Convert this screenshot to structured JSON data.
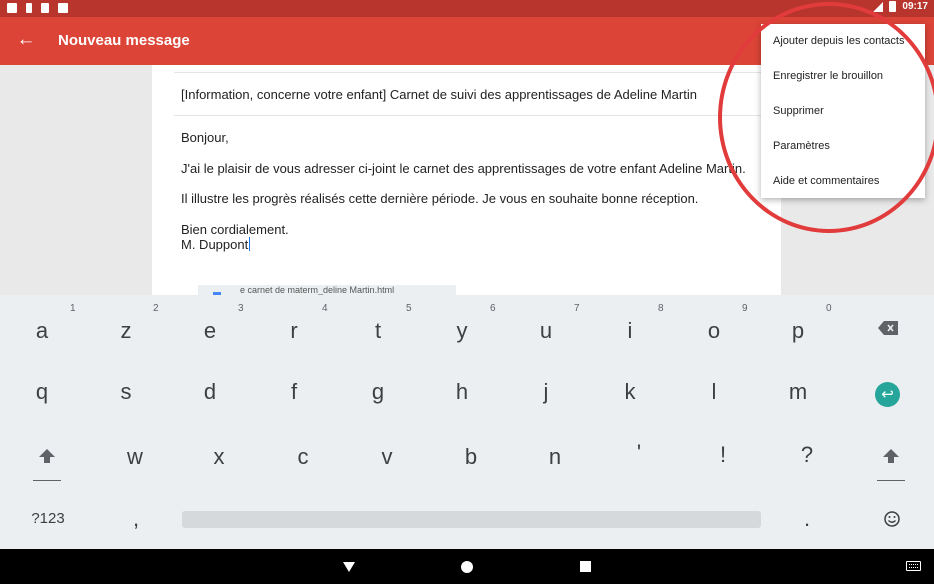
{
  "status_bar": {
    "time": "09:17",
    "left_icons": [
      "mail-icon",
      "notification-icon",
      "sd-card-icon",
      "app-icon"
    ],
    "right_icons": [
      "wifi-icon",
      "signal-icon",
      "battery-icon"
    ]
  },
  "app_bar": {
    "title": "Nouveau message",
    "back_icon": "arrow-left-icon",
    "color": "#db4437"
  },
  "compose": {
    "subject": "[Information, concerne votre enfant] Carnet de suivi des apprentissages de Adeline Martin",
    "body": {
      "greeting": "Bonjour,",
      "line1": "J'ai le plaisir de vous adresser ci-joint le carnet des apprentissages de votre enfant Adeline Martin.",
      "line2": "Il illustre les progrès réalisés cette dernière période. Je vous en souhaite bonne réception.",
      "closing": "Bien cordialement.",
      "signature": "M. Duppont"
    },
    "attachment_name": "e carnet de materm_deline Martin.html"
  },
  "overflow_menu": {
    "items": [
      "Ajouter depuis les contacts",
      "Enregistrer le brouillon",
      "Supprimer",
      "Paramètres",
      "Aide et commentaires"
    ]
  },
  "annotation": {
    "color": "#e23b3b"
  },
  "keyboard": {
    "row1": [
      {
        "key": "a",
        "hint": "1"
      },
      {
        "key": "z",
        "hint": "2"
      },
      {
        "key": "e",
        "hint": "3"
      },
      {
        "key": "r",
        "hint": "4"
      },
      {
        "key": "t",
        "hint": "5"
      },
      {
        "key": "y",
        "hint": "6"
      },
      {
        "key": "u",
        "hint": "7"
      },
      {
        "key": "i",
        "hint": "8"
      },
      {
        "key": "o",
        "hint": "9"
      },
      {
        "key": "p",
        "hint": "0"
      }
    ],
    "row2": [
      "q",
      "s",
      "d",
      "f",
      "g",
      "h",
      "j",
      "k",
      "l",
      "m"
    ],
    "row3": [
      "w",
      "x",
      "c",
      "v",
      "b",
      "n",
      "'",
      "!",
      "?"
    ],
    "symbols_label": "?123",
    "comma": ",",
    "period": ".",
    "backspace_icon": "backspace-icon",
    "enter_icon": "enter-icon",
    "shift_icon": "shift-icon",
    "emoji_icon": "emoji-icon",
    "enter_color": "#26a69a"
  },
  "nav_bar": {
    "icons": [
      "nav-back-icon",
      "nav-home-icon",
      "nav-recents-icon",
      "keyboard-switch-icon"
    ]
  }
}
